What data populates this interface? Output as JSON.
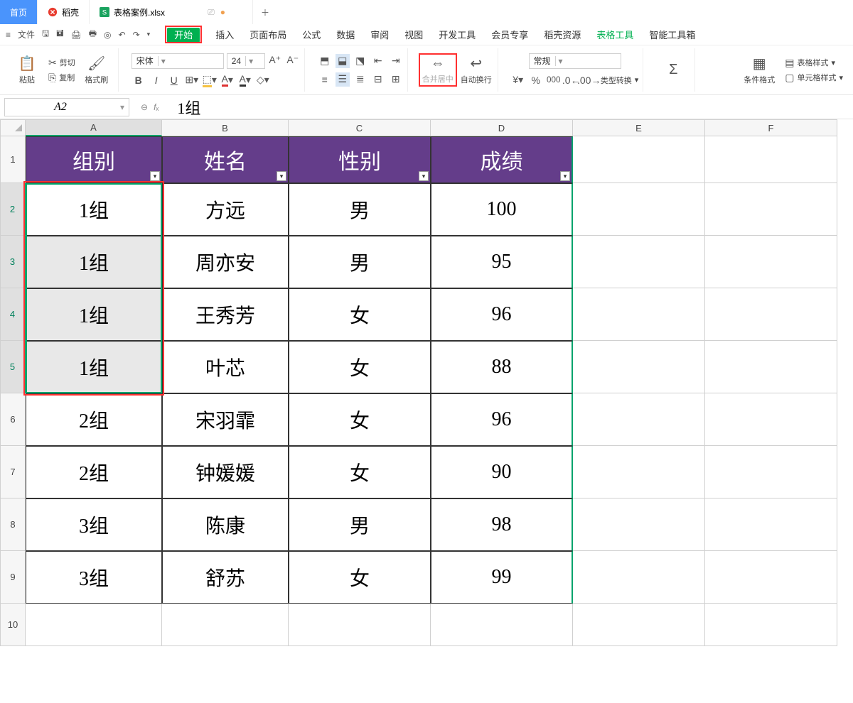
{
  "tabs": {
    "home": "首页",
    "daoke": "稻壳",
    "file": "表格案例.xlsx"
  },
  "qat": {
    "file": "文件"
  },
  "menus": [
    "开始",
    "插入",
    "页面布局",
    "公式",
    "数据",
    "审阅",
    "视图",
    "开发工具",
    "会员专享",
    "稻壳资源",
    "表格工具",
    "智能工具箱"
  ],
  "ribbon": {
    "paste": "粘贴",
    "cut": "剪切",
    "copy": "复制",
    "format_painter": "格式刷",
    "font_name": "宋体",
    "font_size": "24",
    "merge_center": "合并居中",
    "wrap_text": "自动换行",
    "number_format": "常规",
    "type_convert": "类型转换",
    "cond_format": "条件格式",
    "table_style": "表格样式",
    "cell_style": "单元格样式"
  },
  "namebox": "A2",
  "formula_value": "1组",
  "columns": [
    "A",
    "B",
    "C",
    "D",
    "E",
    "F"
  ],
  "table": {
    "headers": [
      "组别",
      "姓名",
      "性别",
      "成绩"
    ],
    "rows": [
      {
        "group": "1组",
        "name": "方远",
        "gender": "男",
        "score": "100"
      },
      {
        "group": "1组",
        "name": "周亦安",
        "gender": "男",
        "score": "95"
      },
      {
        "group": "1组",
        "name": "王秀芳",
        "gender": "女",
        "score": "96"
      },
      {
        "group": "1组",
        "name": "叶芯",
        "gender": "女",
        "score": "88"
      },
      {
        "group": "2组",
        "name": "宋羽霏",
        "gender": "女",
        "score": "96"
      },
      {
        "group": "2组",
        "name": "钟媛媛",
        "gender": "女",
        "score": "90"
      },
      {
        "group": "3组",
        "name": "陈康",
        "gender": "男",
        "score": "98"
      },
      {
        "group": "3组",
        "name": "舒苏",
        "gender": "女",
        "score": "99"
      }
    ]
  },
  "row_labels": [
    "1",
    "2",
    "3",
    "4",
    "5",
    "6",
    "7",
    "8",
    "9",
    "10"
  ]
}
